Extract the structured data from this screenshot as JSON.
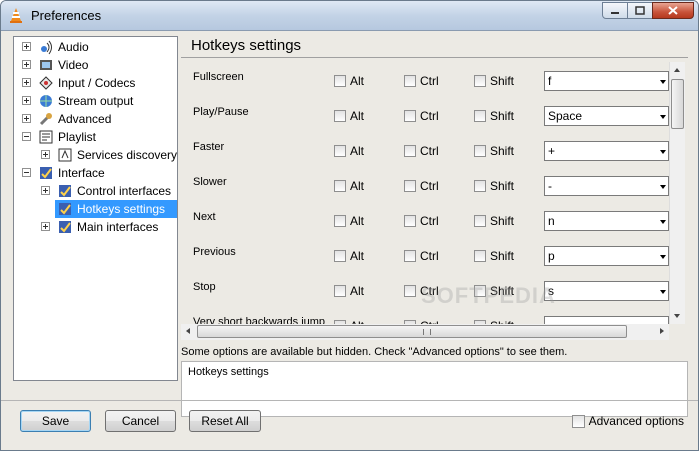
{
  "window": {
    "title": "Preferences"
  },
  "tree": {
    "items": [
      {
        "label": "Audio",
        "icon": "audio-icon",
        "expander": "plus"
      },
      {
        "label": "Video",
        "icon": "video-icon",
        "expander": "plus"
      },
      {
        "label": "Input / Codecs",
        "icon": "codecs-icon",
        "expander": "plus"
      },
      {
        "label": "Stream output",
        "icon": "stream-output-icon",
        "expander": "plus"
      },
      {
        "label": "Advanced",
        "icon": "advanced-icon",
        "expander": "plus"
      },
      {
        "label": "Playlist",
        "icon": "playlist-icon",
        "expander": "minus"
      },
      {
        "label": "Services discovery",
        "icon": "services-icon",
        "expander": "plus"
      },
      {
        "label": "Interface",
        "icon": "interface-icon",
        "expander": "minus"
      },
      {
        "label": "Control interfaces",
        "icon": "control-interfaces-icon",
        "expander": "plus"
      },
      {
        "label": "Hotkeys settings",
        "icon": "hotkeys-icon",
        "expander": "none",
        "selected": true
      },
      {
        "label": "Main interfaces",
        "icon": "main-interfaces-icon",
        "expander": "plus"
      }
    ]
  },
  "panel": {
    "title": "Hotkeys settings",
    "modifiers": [
      "Alt",
      "Ctrl",
      "Shift"
    ],
    "hotkeys": [
      {
        "label": "Fullscreen",
        "key": "f"
      },
      {
        "label": "Play/Pause",
        "key": "Space"
      },
      {
        "label": "Faster",
        "key": "+"
      },
      {
        "label": "Slower",
        "key": "-"
      },
      {
        "label": "Next",
        "key": "n"
      },
      {
        "label": "Previous",
        "key": "p"
      },
      {
        "label": "Stop",
        "key": "s"
      },
      {
        "label": "Very short backwards jump",
        "key": ""
      }
    ],
    "hidden_note": "Some options are available but hidden. Check \"Advanced options\" to see them.",
    "hint": "Hotkeys settings"
  },
  "buttons": {
    "save": "Save",
    "cancel": "Cancel",
    "reset": "Reset All"
  },
  "advanced_options": "Advanced options",
  "watermark": "SOFTPEDIA",
  "colors": {
    "selection": "#3399ff",
    "window_bg": "#eceae4"
  }
}
